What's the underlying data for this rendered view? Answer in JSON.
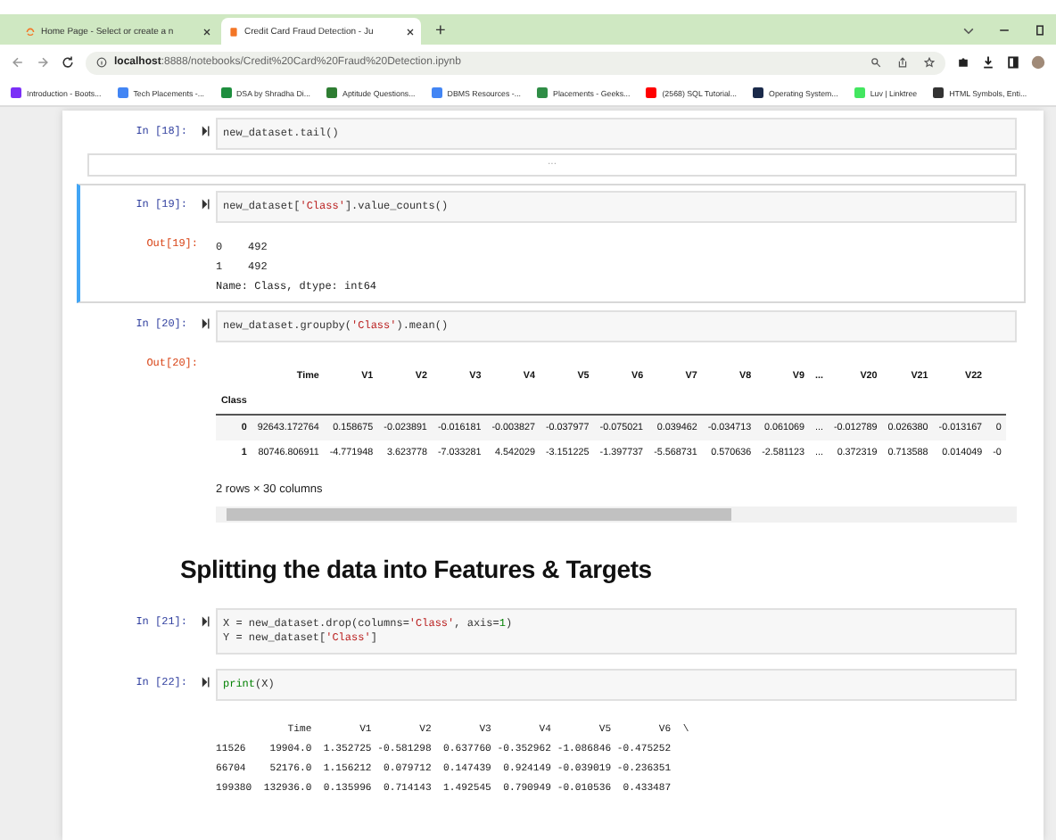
{
  "browser": {
    "tabs": [
      {
        "title": "Home Page - Select or create a n",
        "selected": false
      },
      {
        "title": "Credit Card Fraud Detection - Ju",
        "selected": true
      }
    ],
    "new_tab": "+",
    "url": {
      "host": "localhost",
      "path": ":8888/notebooks/Credit%20Card%20Fraud%20Detection.ipynb"
    },
    "bookmarks": [
      {
        "label": "Introduction - Boots...",
        "color": "#7b2ff7"
      },
      {
        "label": "Tech Placements -...",
        "color": "#4285f4"
      },
      {
        "label": "DSA by Shradha Di...",
        "color": "#1e8e3e"
      },
      {
        "label": "Aptitude Questions...",
        "color": "#2e7d32"
      },
      {
        "label": "DBMS Resources -...",
        "color": "#4285f4"
      },
      {
        "label": "Placements - Geeks...",
        "color": "#2f8d46"
      },
      {
        "label": "(2568) SQL Tutorial...",
        "color": "#ff0000"
      },
      {
        "label": "Operating System...",
        "color": "#1a2a4a"
      },
      {
        "label": "Luv | Linktree",
        "color": "#43e660"
      },
      {
        "label": "HTML Symbols, Enti...",
        "color": "#333333"
      }
    ]
  },
  "cells": [
    {
      "kind": "code",
      "prompt": "In [18]:",
      "selected": false,
      "code": [
        [
          {
            "t": "new_dataset.tail()",
            "kind": "plain"
          }
        ]
      ],
      "output": {
        "kind": "collapsed",
        "text": "..."
      }
    },
    {
      "kind": "code",
      "prompt": "In [19]:",
      "selected": true,
      "code": [
        [
          {
            "t": "new_dataset[",
            "kind": "plain"
          },
          {
            "t": "'Class'",
            "kind": "string"
          },
          {
            "t": "].value_counts()",
            "kind": "plain"
          }
        ]
      ],
      "output": {
        "kind": "text",
        "prompt": "Out[19]:",
        "lines": [
          "0    492",
          "1    492",
          "Name: Class, dtype: int64"
        ]
      }
    },
    {
      "kind": "code",
      "prompt": "In [20]:",
      "selected": false,
      "code": [
        [
          {
            "t": "new_dataset.groupby(",
            "kind": "plain"
          },
          {
            "t": "'Class'",
            "kind": "string"
          },
          {
            "t": ").mean()",
            "kind": "plain"
          }
        ]
      ],
      "output": {
        "kind": "dataframe",
        "prompt": "Out[20]:",
        "columns": [
          "",
          "Time",
          "V1",
          "V2",
          "V3",
          "V4",
          "V5",
          "V6",
          "V7",
          "V8",
          "V9",
          "...",
          "V20",
          "V21",
          "V22"
        ],
        "index_name": "Class",
        "rows": [
          [
            "0",
            "92643.172764",
            "0.158675",
            "-0.023891",
            "-0.016181",
            "-0.003827",
            "-0.037977",
            "-0.075021",
            "0.039462",
            "-0.034713",
            "0.061069",
            "...",
            "-0.012789",
            "0.026380",
            "-0.013167",
            "0"
          ],
          [
            "1",
            "80746.806911",
            "-4.771948",
            "3.623778",
            "-7.033281",
            "4.542029",
            "-3.151225",
            "-1.397737",
            "-5.568731",
            "0.570636",
            "-2.581123",
            "...",
            "0.372319",
            "0.713588",
            "0.014049",
            "-0"
          ]
        ],
        "footer": "2 rows × 30 columns"
      }
    },
    {
      "kind": "heading",
      "text": "Splitting the data into Features & Targets"
    },
    {
      "kind": "code",
      "prompt": "In [21]:",
      "selected": false,
      "code": [
        [
          {
            "t": "X = new_dataset.drop(columns=",
            "kind": "plain"
          },
          {
            "t": "'Class'",
            "kind": "string"
          },
          {
            "t": ", axis=",
            "kind": "plain"
          },
          {
            "t": "1",
            "kind": "number"
          },
          {
            "t": ")",
            "kind": "plain"
          }
        ],
        [
          {
            "t": "Y = new_dataset[",
            "kind": "plain"
          },
          {
            "t": "'Class'",
            "kind": "string"
          },
          {
            "t": "]",
            "kind": "plain"
          }
        ]
      ]
    },
    {
      "kind": "code",
      "prompt": "In [22]:",
      "selected": false,
      "code": [
        [
          {
            "t": "print",
            "kind": "builtin"
          },
          {
            "t": "(X)",
            "kind": "plain"
          }
        ]
      ],
      "output": {
        "kind": "stream",
        "lines": [
          "            Time        V1        V2        V3        V4        V5        V6  \\",
          "11526    19904.0  1.352725 -0.581298  0.637760 -0.352962 -1.086846 -0.475252",
          "66704    52176.0  1.156212  0.079712  0.147439  0.924149 -0.039019 -0.236351",
          "199380  132936.0  0.135996  0.714143  1.492545  0.790949 -0.010536  0.433487"
        ]
      }
    }
  ]
}
